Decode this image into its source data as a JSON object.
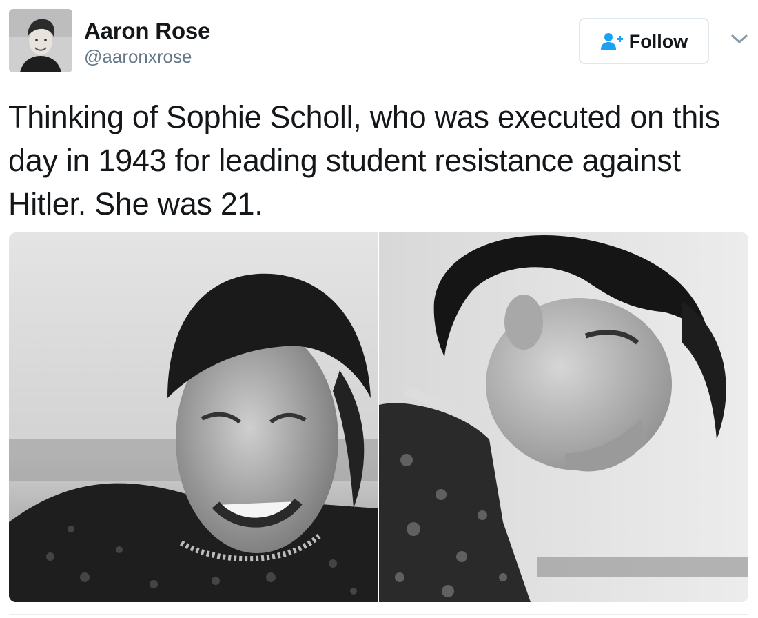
{
  "author": {
    "name": "Aaron Rose",
    "handle": "@aaronxrose",
    "avatar_icon": "profile-photo"
  },
  "actions": {
    "follow_label": "Follow",
    "follow_icon": "person-plus-icon",
    "more_icon": "chevron-down-icon"
  },
  "tweet": {
    "text": "Thinking of Sophie Scholl, who was executed on this day in 1943 for leading student resistance against Hitler. She was 21."
  },
  "media": {
    "photos": [
      {
        "id": "photo-1",
        "style": "black-and-white portrait, smiling"
      },
      {
        "id": "photo-2",
        "style": "black-and-white profile portrait, eyes closed"
      }
    ]
  },
  "colors": {
    "text": "#14171a",
    "secondary_text": "#657786",
    "accent": "#1da1f2",
    "border": "#e1e8ed"
  }
}
